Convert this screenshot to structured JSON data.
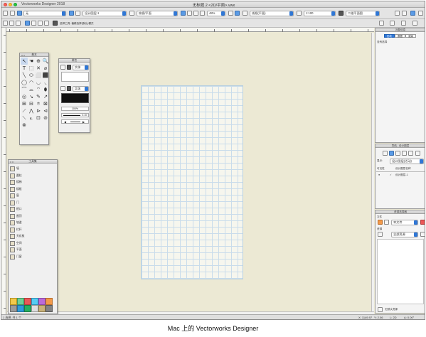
{
  "window": {
    "app_name": "Vectorworks Designer 2018",
    "doc_title": "无标题 2 <2D/平面>.vwx"
  },
  "toolbar": {
    "layer_class": "无",
    "sheet_layer": "设计图层-1",
    "view": "俯视/平面",
    "zoom": "48%",
    "render_mode": "线框(平面)",
    "scale": "1:100",
    "options": "二维平面图"
  },
  "mode_bar": {
    "hint": "选择工具: 偏移选择(默认)模式"
  },
  "palettes": {
    "basic": {
      "title": "基本",
      "tools": [
        "↖",
        "☚",
        "⊕",
        "🔍",
        "T",
        "⬚",
        "✕",
        "⌀",
        "╲",
        "⬭",
        "⬜",
        "⬛",
        "◯",
        "◠",
        "◡",
        "◟",
        "⌒",
        "⌓",
        "⌔",
        "⬮",
        "◎",
        "↘",
        "✎",
        "↗",
        "⊞",
        "⊟",
        "⌾",
        "⊠",
        "⟋",
        "⋀",
        "⊳",
        "⊲",
        "⟍",
        "⟀",
        "⊡",
        "⊘",
        "⊗"
      ]
    },
    "attributes": {
      "title": "属性",
      "fill_label": "实体",
      "pen_label": "实体",
      "opacity": "100%",
      "line_weight": "0.10"
    },
    "building": {
      "title": "工具集",
      "items": [
        "墙",
        "圆柱",
        "楼梯",
        "楼板",
        "窗",
        "门",
        "檐口",
        "屋顶",
        "坡道",
        "栏杆",
        "天花板",
        "空间",
        "平面",
        "门窗"
      ]
    }
  },
  "panels": {
    "obj_info": {
      "title": "对象信息",
      "tabs": [
        "形状",
        "数据",
        "渲染"
      ],
      "empty_text": "没有选择"
    },
    "nav": {
      "title": "导航 - 设计图层",
      "dropdown": "设计图层(活动)",
      "col_visible": "可见性",
      "col_name": "设计图层名称",
      "layer_name": "设计图层-1"
    },
    "resources": {
      "title": "资源选择器",
      "file_label": "文件",
      "file_value": "本文件",
      "res_label": "资源",
      "res_value": "全部资源",
      "bottom_label": "无默认资源"
    }
  },
  "status": {
    "left": "1 选择, 共 1 个",
    "coords": [
      "X: 1149.97",
      "Y: 2.06",
      "L: 2D",
      "A: 0.00°"
    ]
  },
  "caption": "Mac 上的 Vectorworks Designer",
  "colors": {
    "accent": "#2e77d8",
    "canvas": "#ece9d4",
    "grid": "#c9dceb"
  }
}
